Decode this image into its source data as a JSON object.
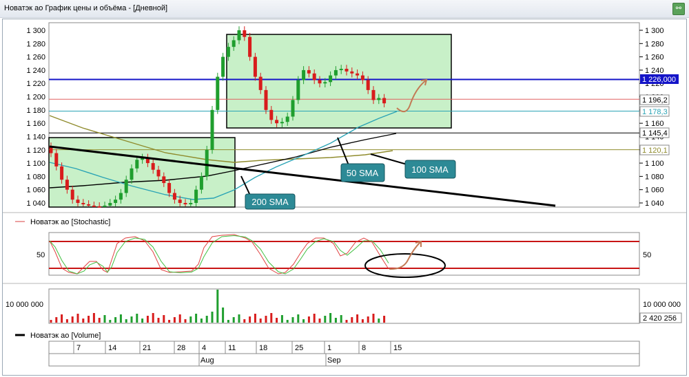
{
  "window": {
    "title": "Новатэк ао График цены и объёма - [Дневной]"
  },
  "price_axis": {
    "ticks": [
      "1 300",
      "1 280",
      "1 260",
      "1 240",
      "1 220",
      "1 200",
      "1 180",
      "1 160",
      "1 140",
      "1 120",
      "1 100",
      "1 080",
      "1 060",
      "1 040"
    ]
  },
  "price_labels": {
    "blue": "1 226,000",
    "red": "1 196,2",
    "teal": "1 178,3",
    "black": "1 145,4",
    "olive": "1 120,1"
  },
  "annotations": {
    "sma50": "50 SMA",
    "sma100": "100 SMA",
    "sma200": "200 SMA"
  },
  "stochastic": {
    "legend": "Новатэк ао [Stochastic]",
    "tick": "50"
  },
  "volume": {
    "tick": "10 000 000",
    "last_value": "2 420 256",
    "legend": "Новатэк ао [Volume]"
  },
  "date_axis": {
    "days": [
      "7",
      "14",
      "21",
      "28",
      "4",
      "11",
      "18",
      "25",
      "1",
      "8",
      "15"
    ],
    "months": [
      "Aug",
      "Sep"
    ]
  },
  "colors": {
    "up": "#1f9e2e",
    "down": "#d81c1c",
    "hline_blue": "#1414c8",
    "hline_red": "#e06060",
    "sma50": "#2aa3b5",
    "sma100": "#8f8b2c",
    "sma200": "#000000",
    "box": "#c8f0c8"
  },
  "chart_data": {
    "type": "candlestick",
    "y_range": [
      1030,
      1310
    ],
    "candles_close": [
      1115,
      1095,
      1075,
      1060,
      1045,
      1040,
      1038,
      1036,
      1035,
      1034,
      1036,
      1040,
      1045,
      1055,
      1075,
      1092,
      1105,
      1108,
      1100,
      1090,
      1080,
      1070,
      1055,
      1045,
      1040,
      1038,
      1040,
      1060,
      1080,
      1120,
      1180,
      1230,
      1260,
      1275,
      1285,
      1300,
      1290,
      1260,
      1230,
      1210,
      1180,
      1165,
      1160,
      1162,
      1170,
      1195,
      1225,
      1240,
      1235,
      1225,
      1220,
      1222,
      1232,
      1240,
      1242,
      1238,
      1235,
      1232,
      1225,
      1210,
      1195,
      1198,
      1190
    ],
    "horizontal_levels": [
      {
        "name": "blue",
        "value": 1226.0
      },
      {
        "name": "red",
        "value": 1196.2
      },
      {
        "name": "teal",
        "value": 1178.3
      },
      {
        "name": "black",
        "value": 1145.4
      },
      {
        "name": "olive",
        "value": 1120.1
      }
    ],
    "series": [
      {
        "name": "50 SMA",
        "color": "teal"
      },
      {
        "name": "100 SMA",
        "color": "olive"
      },
      {
        "name": "200 SMA",
        "color": "black"
      }
    ],
    "x_ticks": [
      "7",
      "14",
      "21",
      "28",
      "4",
      "11",
      "18",
      "25",
      "1",
      "8",
      "15"
    ]
  }
}
